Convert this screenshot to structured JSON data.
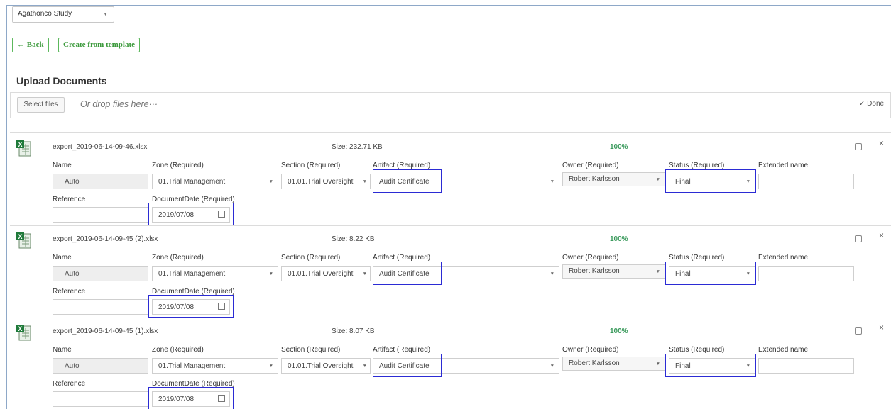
{
  "study_selector": {
    "value": "Agathonco Study"
  },
  "toolbar": {
    "back_label": "← Back",
    "template_label": "Create from template"
  },
  "page_title": "Upload Documents",
  "upload": {
    "select_label": "Select files",
    "drop_hint": "Or drop files here···",
    "done_label": "Done"
  },
  "labels": {
    "name": "Name",
    "zone": "Zone (Required)",
    "section": "Section (Required)",
    "artifact": "Artifact (Required)",
    "owner": "Owner (Required)",
    "status": "Status (Required)",
    "extended": "Extended name",
    "reference": "Reference",
    "docdate": "DocumentDate (Required)"
  },
  "files": [
    {
      "filename": "export_2019-06-14-09-46.xlsx",
      "size": "Size: 232.71 KB",
      "progress": "100%",
      "name": "Auto",
      "zone": "01.Trial Management",
      "section": "01.01.Trial Oversight",
      "artifact": "Audit Certificate",
      "owner": "Robert Karlsson",
      "status": "Final",
      "extended": "",
      "reference": "",
      "docdate": "2019/07/08"
    },
    {
      "filename": "export_2019-06-14-09-45 (2).xlsx",
      "size": "Size: 8.22 KB",
      "progress": "100%",
      "name": "Auto",
      "zone": "01.Trial Management",
      "section": "01.01.Trial Oversight",
      "artifact": "Audit Certificate",
      "owner": "Robert Karlsson",
      "status": "Final",
      "extended": "",
      "reference": "",
      "docdate": "2019/07/08"
    },
    {
      "filename": "export_2019-06-14-09-45 (1).xlsx",
      "size": "Size: 8.07 KB",
      "progress": "100%",
      "name": "Auto",
      "zone": "01.Trial Management",
      "section": "01.01.Trial Oversight",
      "artifact": "Audit Certificate",
      "owner": "Robert Karlsson",
      "status": "Final",
      "extended": "",
      "reference": "",
      "docdate": "2019/07/08"
    }
  ],
  "colors": {
    "accent_green": "#5cb85c",
    "highlight_blue": "#2b2bd4",
    "progress_green": "#3a9a5c"
  },
  "icons": {
    "file": "excel-file-icon",
    "copy": "copy-icon",
    "close": "close-icon",
    "calendar": "calendar-icon",
    "check": "check-icon",
    "dropdown": "chevron-down-icon"
  }
}
